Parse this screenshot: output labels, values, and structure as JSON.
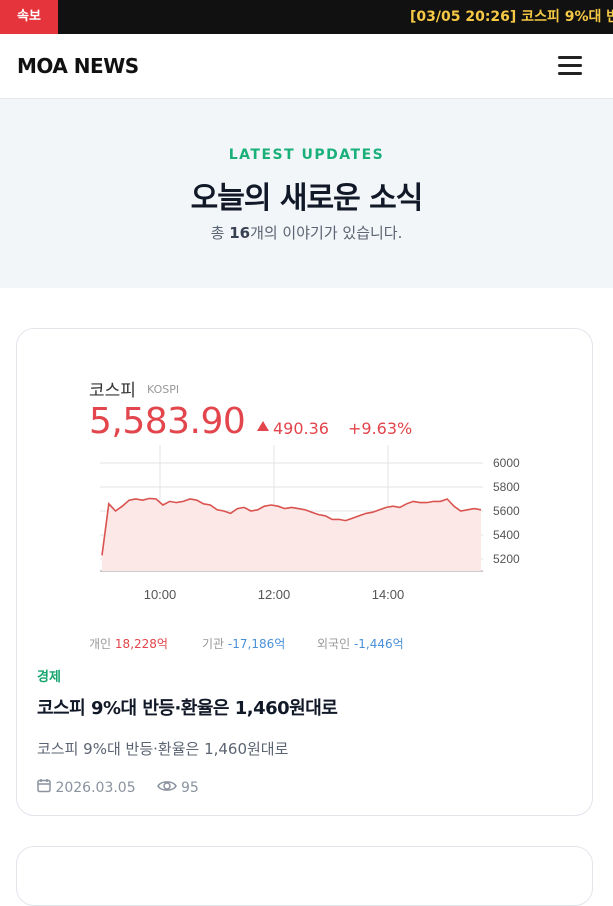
{
  "ticker": {
    "badge": "속보",
    "headline": "[03/05 20:26] 코스피 9%대 반"
  },
  "header": {
    "logo": "MOA NEWS",
    "menu_icon": "hamburger-menu-icon"
  },
  "hero": {
    "kicker": "LATEST UPDATES",
    "title": "오늘의 새로운 소식",
    "subtitle_prefix": "총 ",
    "subtitle_count": "16",
    "subtitle_suffix": "개의 이야기가 있습니다."
  },
  "articles": [
    {
      "image": {
        "stock_name": "코스피",
        "stock_code": "KOSPI",
        "price": "5,583.90",
        "change": "490.36",
        "change_pct": "+9.63%",
        "investors": [
          {
            "label": "개인",
            "value": "18,228억",
            "sign": "pos"
          },
          {
            "label": "기관",
            "value": "-17,186억",
            "sign": "neg"
          },
          {
            "label": "외국인",
            "value": "-1,446억",
            "sign": "neg"
          }
        ],
        "chart_data": {
          "type": "area",
          "x_ticks": [
            "10:00",
            "12:00",
            "14:00"
          ],
          "y_ticks": [
            "6000",
            "5800",
            "5600",
            "5400",
            "5200"
          ],
          "ylim": [
            5100,
            6100
          ],
          "values": [
            5230,
            5660,
            5600,
            5640,
            5690,
            5700,
            5690,
            5705,
            5700,
            5650,
            5680,
            5670,
            5680,
            5700,
            5690,
            5660,
            5650,
            5610,
            5600,
            5580,
            5620,
            5630,
            5600,
            5610,
            5640,
            5650,
            5640,
            5620,
            5630,
            5620,
            5610,
            5590,
            5570,
            5560,
            5530,
            5530,
            5520,
            5540,
            5560,
            5580,
            5590,
            5610,
            5630,
            5640,
            5630,
            5660,
            5680,
            5670,
            5670,
            5680,
            5680,
            5700,
            5640,
            5600,
            5610,
            5620,
            5610
          ]
        }
      },
      "category": "경제",
      "title": "코스피 9%대 반등·환율은 1,460원대로",
      "description": "코스피 9%대 반등·환율은 1,460원대로",
      "date": "2026.03.05",
      "views": "95",
      "date_icon": "calendar-icon",
      "views_icon": "eye-icon"
    }
  ],
  "colors": {
    "ticker_bg": "#111111",
    "badge_bg": "#e5343b",
    "ticker_text": "#f6c945",
    "accent_green": "#19b07a",
    "price_red": "#e2454b",
    "negative_blue": "#4a90d9"
  }
}
